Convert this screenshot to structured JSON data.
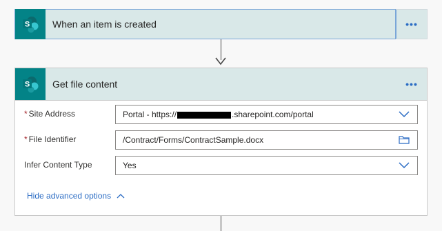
{
  "trigger": {
    "title": "When an item is created",
    "icon": "sharepoint-icon",
    "more_label": "•••"
  },
  "action": {
    "title": "Get file content",
    "icon": "sharepoint-icon",
    "more_label": "•••",
    "fields": {
      "site_address": {
        "label": "Site Address",
        "required_mark": "*",
        "value_prefix": "Portal - https://",
        "value_suffix": ".sharepoint.com/portal"
      },
      "file_identifier": {
        "label": "File Identifier",
        "required_mark": "*",
        "value": "/Contract/Forms/ContractSample.docx"
      },
      "infer_content_type": {
        "label": "Infer Content Type",
        "value": "Yes"
      }
    },
    "advanced_toggle": "Hide advanced options"
  },
  "colors": {
    "header_bg": "#d9e8e8",
    "sharepoint_teal": "#038387",
    "accent_blue": "#2b6cc4",
    "required_red": "#a4262c"
  }
}
